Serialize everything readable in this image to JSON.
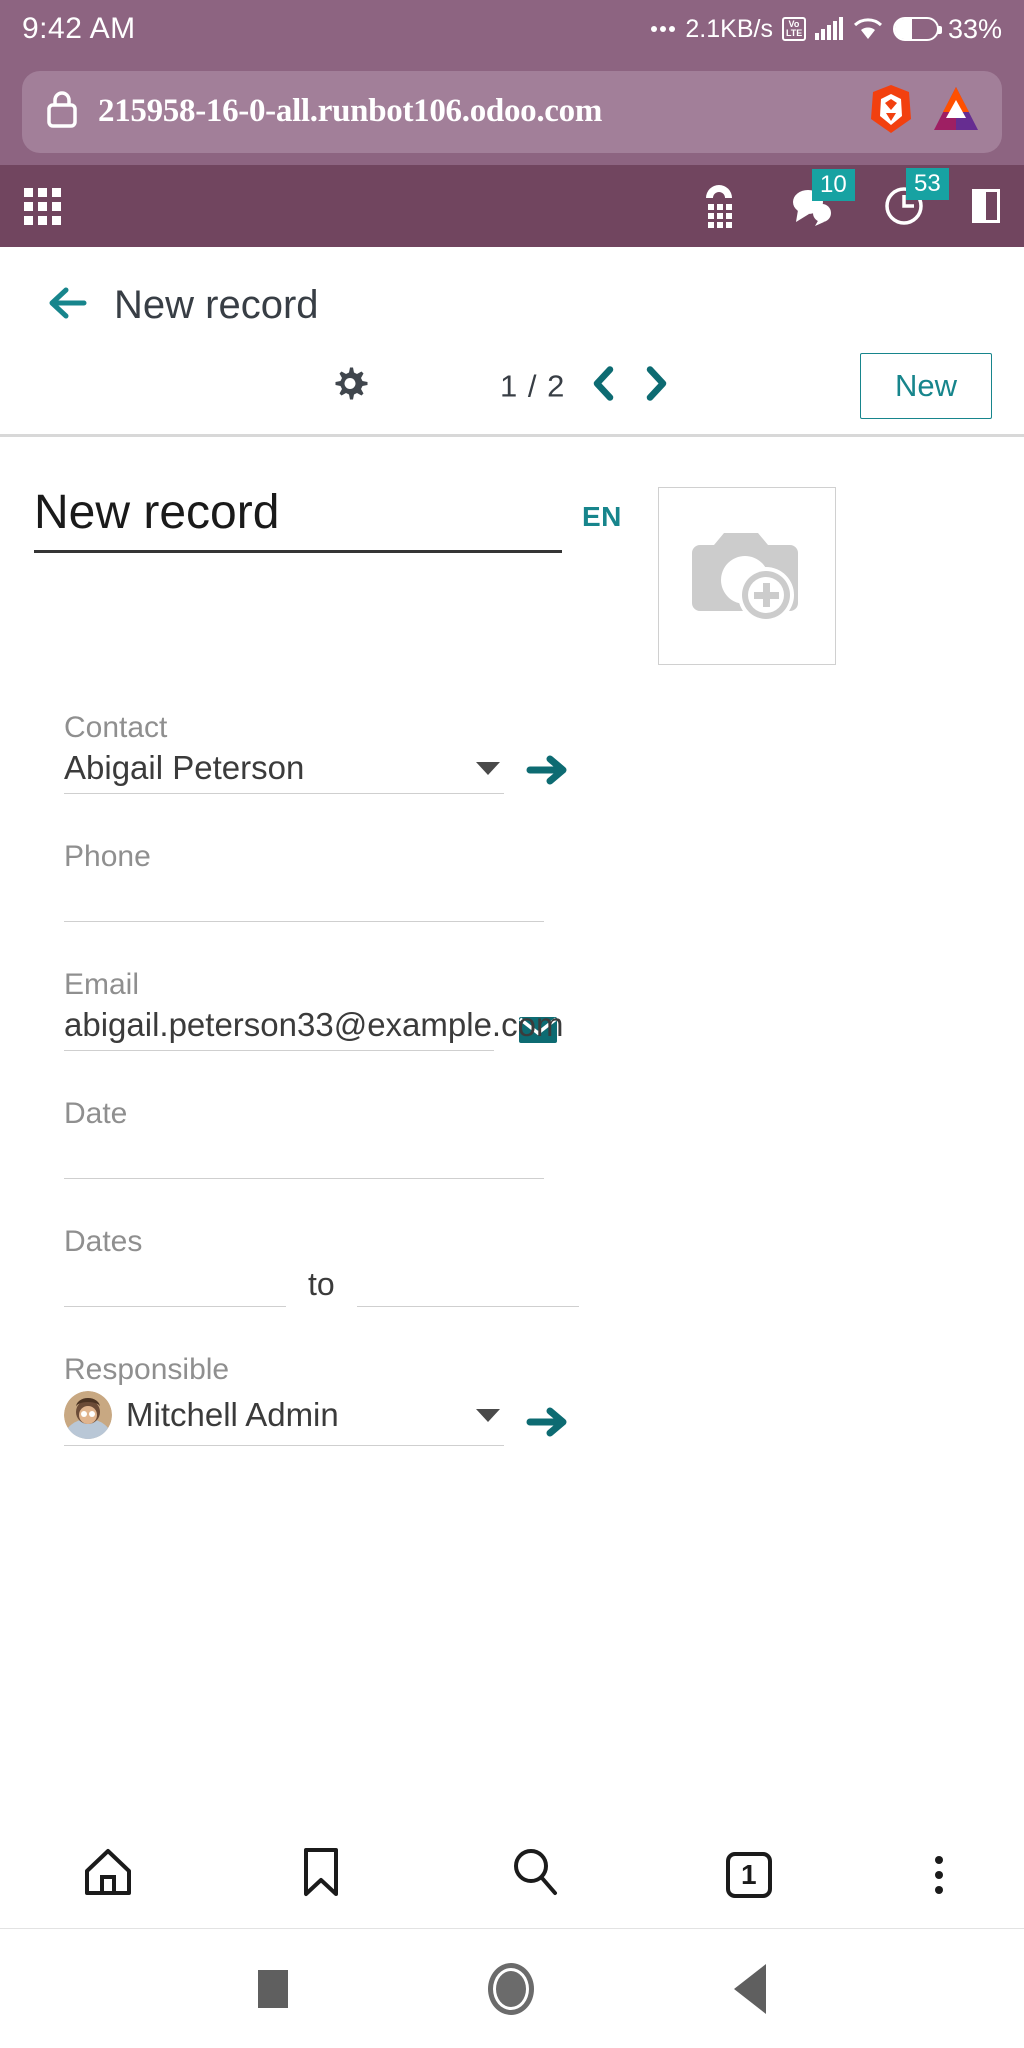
{
  "status_bar": {
    "clock": "9:42 AM",
    "data_rate": "2.1KB/s",
    "network_type_top": "Vo",
    "network_type_bottom": "LTE",
    "battery_percent": "33%"
  },
  "browser": {
    "url": "215958-16-0-all.runbot106.odoo.com",
    "lock_icon": "lock-icon",
    "brave_icon": "brave-lion-icon",
    "bat_icon": "bat-token-icon",
    "toolbar": {
      "home": "home-icon",
      "bookmarks": "bookmark-icon",
      "search": "search-icon",
      "tab_count": "1",
      "menu": "kebab-menu-icon"
    }
  },
  "odoo_navbar": {
    "apps_menu": "apps-grid-icon",
    "voip_icon": "phone-dialpad-icon",
    "messages_icon": "chat-bubble-icon",
    "messages_count": "10",
    "activities_icon": "clock-icon",
    "activities_count": "53",
    "panel_icon": "side-panel-icon"
  },
  "control_panel": {
    "back_icon": "arrow-left-icon",
    "breadcrumb": "New record",
    "settings_icon": "gear-icon",
    "pager_text": "1 / 2",
    "prev_icon": "chevron-left-icon",
    "next_icon": "chevron-right-icon",
    "new_button": "New"
  },
  "form": {
    "title": "New record",
    "lang_badge": "EN",
    "image_placeholder": "camera-add-icon",
    "fields": [
      {
        "name": "contact",
        "label": "Contact",
        "value": "Abigail Peterson",
        "placeholder": "",
        "has_dropdown": true,
        "suffix_icon": "internal-link-arrow-icon"
      },
      {
        "name": "phone",
        "label": "Phone",
        "value": "",
        "placeholder": "",
        "has_dropdown": false,
        "suffix_icon": ""
      },
      {
        "name": "email",
        "label": "Email",
        "value": "abigail.peterson33@example.com",
        "placeholder": "",
        "has_dropdown": false,
        "suffix_icon": "envelope-icon"
      },
      {
        "name": "date",
        "label": "Date",
        "value": "",
        "placeholder": "",
        "has_dropdown": false,
        "suffix_icon": ""
      }
    ],
    "dates_field": {
      "label": "Dates",
      "start_value": "",
      "end_value": "",
      "separator": "to"
    },
    "responsible_field": {
      "label": "Responsible",
      "value": "Mitchell Admin",
      "avatar": "user-avatar",
      "has_dropdown": true,
      "suffix_icon": "internal-link-arrow-icon"
    }
  },
  "colors": {
    "status_bar_bg": "#8d6481",
    "url_bar_bg": "#a27f99",
    "odoo_navbar_bg": "#71455f",
    "accent_teal": "#17858c",
    "badge_teal": "#17a2a2"
  }
}
